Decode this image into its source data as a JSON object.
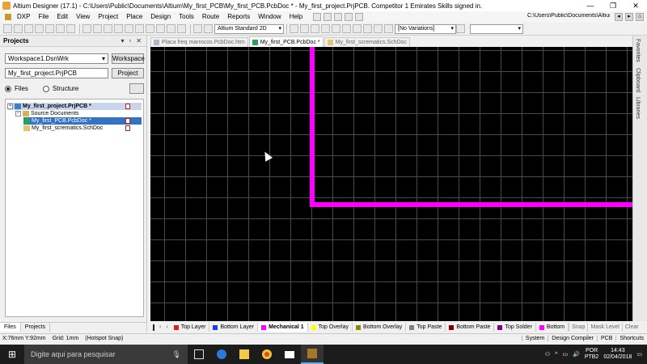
{
  "window": {
    "title": "Altium Designer (17.1) - C:\\Users\\Public\\Documents\\Altium\\My_first_PCB\\My_first_PCB.PcbDoc * - My_first_project.PrjPCB. Competitor 1 Emirates Skills signed in.",
    "controls": [
      "—",
      "❐",
      "✕"
    ]
  },
  "menu": {
    "items": [
      "DXP",
      "File",
      "Edit",
      "View",
      "Project",
      "Place",
      "Design",
      "Tools",
      "Route",
      "Reports",
      "Window",
      "Help"
    ],
    "path": "C:\\Users\\Public\\Documents\\Altiun"
  },
  "toolbar": {
    "view_mode": "Altium Standard 2D",
    "variations": "[No Variations]",
    "blank_select": ""
  },
  "projects_panel": {
    "title": "Projects",
    "controls": [
      "▾",
      "▫",
      "✕"
    ],
    "workspace_value": "Workspace1.DsnWrk",
    "workspace_button": "Workspace",
    "project_value": "My_first_project.PrjPCB",
    "project_button": "Project",
    "radio_files": "Files",
    "radio_structure": "Structure",
    "tree": {
      "project": "My_first_project.PrjPCB *",
      "folder": "Source Documents",
      "docs": [
        "My_first_PCB.PcbDoc *",
        "My_first_scrematics.SchDoc"
      ]
    },
    "tabs": [
      "Files",
      "Projects"
    ]
  },
  "doc_tabs": [
    {
      "label": "Placa freq marrocos.PcbDoc.htm",
      "active": false
    },
    {
      "label": "My_first_PCB.PcbDoc *",
      "active": true
    },
    {
      "label": "My_first_scrematics.SchDoc",
      "active": false
    }
  ],
  "side_panels": [
    "Favorites",
    "Clipboard",
    "Libraries"
  ],
  "layers": {
    "tabs": [
      {
        "label": "Top Layer",
        "color": "#e02020"
      },
      {
        "label": "Bottom Layer",
        "color": "#1a3cff"
      },
      {
        "label": "Mechanical 1",
        "color": "#ff00ff",
        "active": true
      },
      {
        "label": "Top Overlay",
        "color": "#ffff00"
      },
      {
        "label": "Bottom Overlay",
        "color": "#8a8a00"
      },
      {
        "label": "Top Paste",
        "color": "#808080"
      },
      {
        "label": "Bottom Paste",
        "color": "#800000"
      },
      {
        "label": "Top Solder",
        "color": "#800080"
      },
      {
        "label": "Bottom",
        "color": "#ff00ff"
      }
    ],
    "buttons": [
      "Snap",
      "Mask Level",
      "Clear"
    ]
  },
  "status": {
    "coords": "X:76mm Y:92mm",
    "grid": "Grid: 1mm",
    "snap": "(Hotspot Snap)",
    "right": [
      "System",
      "Design Compiler",
      "PCB",
      "Shortcuts"
    ]
  },
  "taskbar": {
    "search_placeholder": "Digite aqui para pesquisar",
    "lang_top": "POR",
    "lang_bottom": "PTB2",
    "time": "14:43",
    "date": "02/04/2018"
  }
}
